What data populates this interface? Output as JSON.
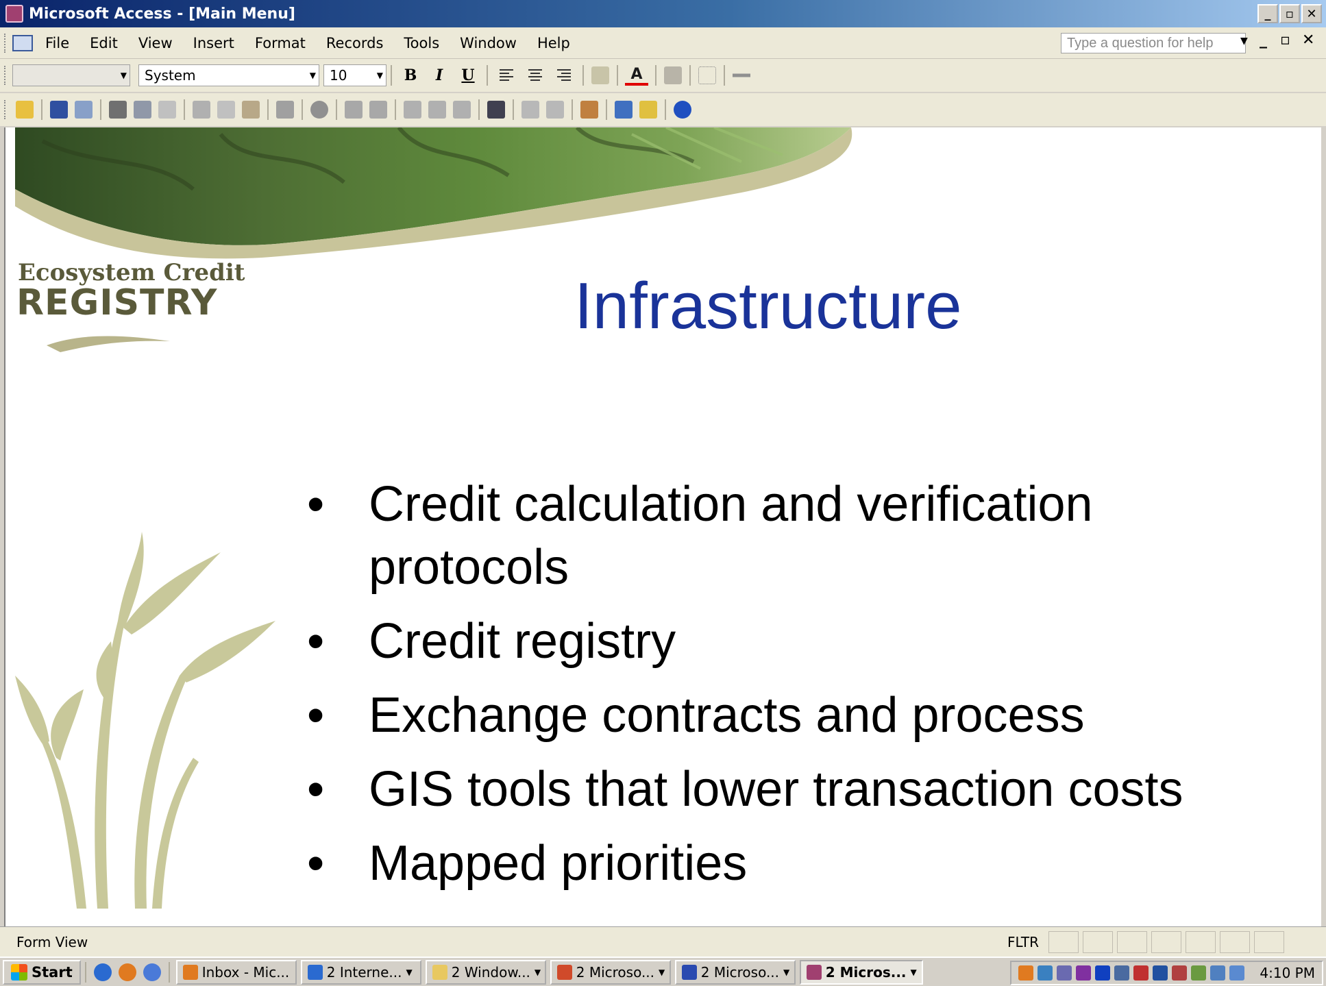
{
  "window": {
    "title": "Microsoft Access - [Main Menu]",
    "controls": [
      "_",
      "▫",
      "✕"
    ]
  },
  "menubar": {
    "items": [
      "File",
      "Edit",
      "View",
      "Insert",
      "Format",
      "Records",
      "Tools",
      "Window",
      "Help"
    ],
    "help_placeholder": "Type a question for help",
    "doc_controls": [
      "_",
      "▫",
      "✕"
    ]
  },
  "formatbar": {
    "object_combo": "",
    "font_combo": "System",
    "size_combo": "10",
    "bold": "B",
    "italic": "I",
    "underline": "U"
  },
  "slide": {
    "logo_line1": "Ecosystem Credit",
    "logo_line2": "REGISTRY",
    "title": "Infrastructure",
    "bullets": [
      "Credit calculation and verification protocols",
      "Credit registry",
      "Exchange contracts and process",
      "GIS tools that lower transaction costs",
      "Mapped priorities"
    ]
  },
  "statusbar": {
    "left": "Form View",
    "flag": "FLTR"
  },
  "taskbar": {
    "start": "Start",
    "tasks": [
      {
        "label": "Inbox - Mic...",
        "color": "#e07a20",
        "arrow": false,
        "active": false
      },
      {
        "label": "2 Interne...",
        "color": "#2a6ad0",
        "arrow": true,
        "active": false
      },
      {
        "label": "2 Window...",
        "color": "#e8c860",
        "arrow": true,
        "active": false
      },
      {
        "label": "2 Microso...",
        "color": "#d04a2a",
        "arrow": true,
        "active": false
      },
      {
        "label": "2 Microso...",
        "color": "#2a4ab0",
        "arrow": true,
        "active": false
      },
      {
        "label": "2 Micros...",
        "color": "#a04070",
        "arrow": true,
        "active": true
      }
    ],
    "clock": "4:10 PM"
  },
  "colors": {
    "title_bar": "#0a246a",
    "slide_title": "#1a3399",
    "logo": "#5a5a3a",
    "plant": "#c8c89a"
  }
}
